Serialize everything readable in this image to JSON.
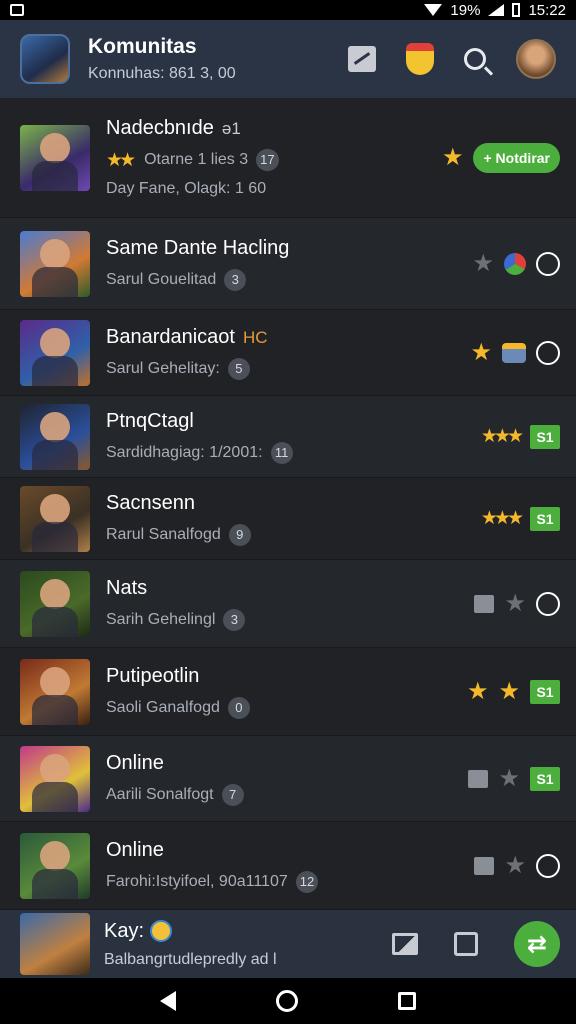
{
  "status_bar": {
    "battery": "19%",
    "time": "15:22"
  },
  "app_bar": {
    "title": "Komunitas",
    "subtitle": "Konnuhas: 861 3, 00"
  },
  "rows": [
    {
      "title": "Nadecbnıde",
      "tag": "ə1",
      "sub": "Otarne 1 lies 3",
      "count": "17",
      "sub2": "Day Fane, Olagk: 1 60",
      "action_label": "Notdirar"
    },
    {
      "title": "Same Dante Hacling",
      "sub": "Sarul Gouelitad",
      "count": "3"
    },
    {
      "title": "Banardanicaot",
      "tag": "HC",
      "sub": "Sarul Gehelitay:",
      "count": "5"
    },
    {
      "title": "PtnqCtagl",
      "sub": "Sardidhagiag: 1/2001:",
      "count": "11",
      "badge": "S1"
    },
    {
      "title": "Sacnsenn",
      "sub": "Rarul Sanalfogd",
      "count": "9",
      "badge": "S1"
    },
    {
      "title": "Nats",
      "sub": "Sarih Gehelingl",
      "count": "3"
    },
    {
      "title": "Putipeotlin",
      "sub": "Saoli Ganalfogd",
      "count": "0",
      "badge": "S1"
    },
    {
      "title": "Online",
      "sub": "Aarili Sonalfogt",
      "count": "7",
      "badge": "S1"
    },
    {
      "title": "Online",
      "sub": "Farohi:Istyifoel, 90a11107",
      "count": "12"
    }
  ],
  "bottom_bar": {
    "title": "Kay:",
    "subtitle": "Balbangrtudlepredly ad l"
  }
}
